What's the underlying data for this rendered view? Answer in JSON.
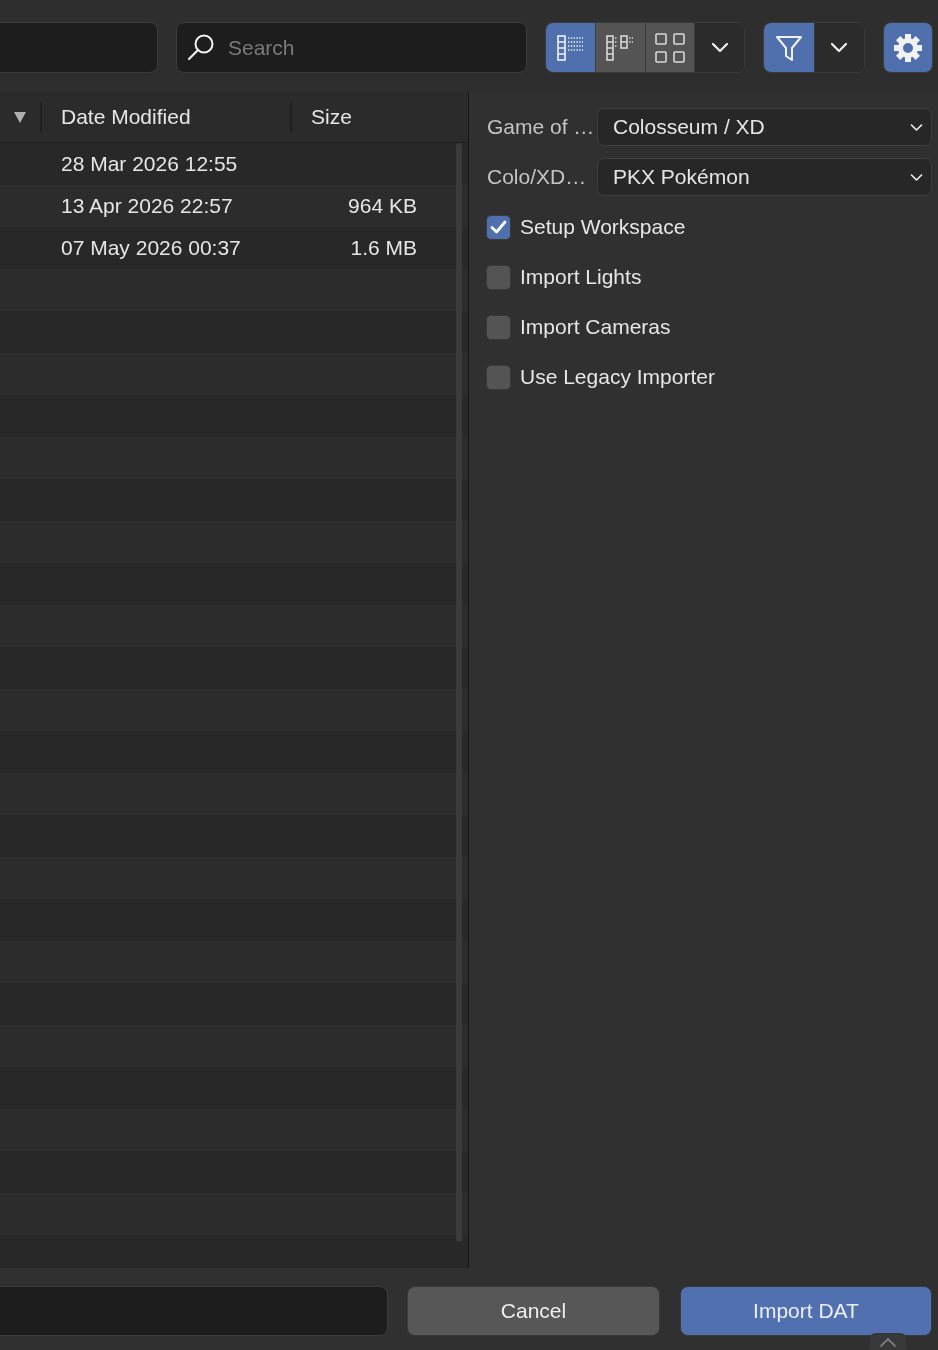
{
  "toolbar": {
    "search": {
      "placeholder": "Search"
    },
    "view_modes": [
      {
        "kind": "vertical_list",
        "selected": true
      },
      {
        "kind": "horizontal_list",
        "selected": false
      },
      {
        "kind": "thumbnails",
        "selected": false
      }
    ],
    "filter": {
      "on": true
    },
    "settings": {
      "on": true
    }
  },
  "file_list": {
    "columns": [
      {
        "label": "Date Modified"
      },
      {
        "label": "Size"
      }
    ],
    "rows": [
      {
        "date_modified": "28 Mar 2026 12:55"
      },
      {
        "date_modified": "13 Apr 2026 22:57",
        "size": "964 KB"
      },
      {
        "date_modified": "07 May 2026 00:37",
        "size": "1.6 MB"
      }
    ]
  },
  "options": {
    "dropdowns": [
      {
        "label": "Game of …",
        "value": "Colosseum / XD"
      },
      {
        "label": "Colo/XD…",
        "value": "PKX Pokémon"
      }
    ],
    "checkboxes": [
      {
        "label": "Setup Workspace",
        "checked": true
      },
      {
        "label": "Import Lights",
        "checked": false
      },
      {
        "label": "Import Cameras",
        "checked": false
      },
      {
        "label": "Use Legacy Importer",
        "checked": false
      }
    ]
  },
  "buttons": [
    {
      "label": "Cancel",
      "kind": "secondary"
    },
    {
      "label": "Import DAT",
      "kind": "primary"
    }
  ]
}
